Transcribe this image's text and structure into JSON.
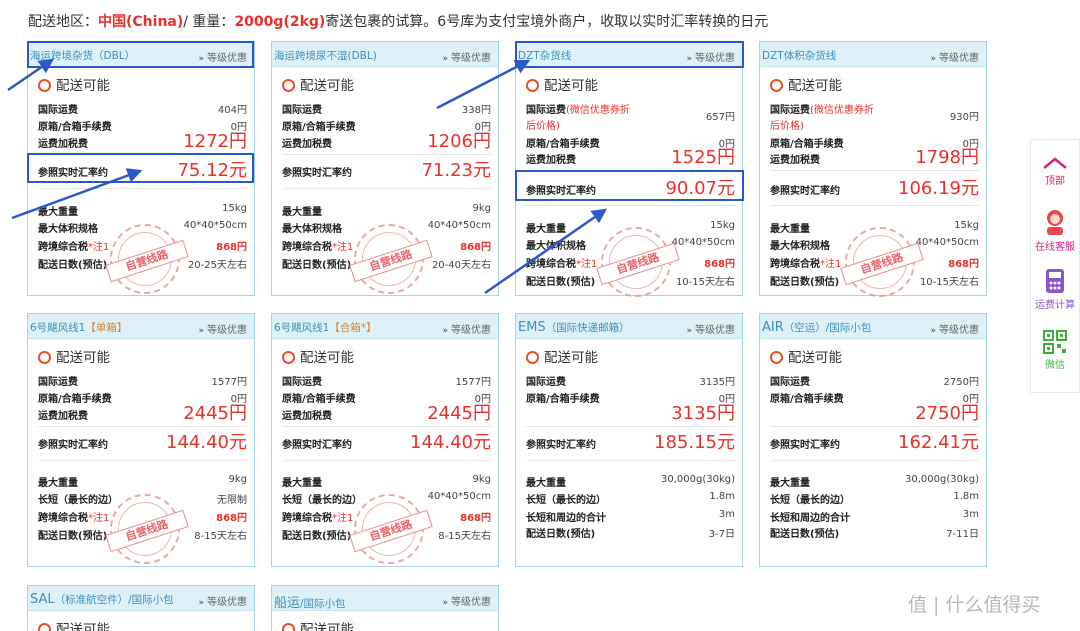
{
  "header": {
    "prefix": "配送地区：",
    "region": "中国(China)",
    "sep": "/ 重量：",
    "weight": "2000g(2kg)",
    "suffix": "寄送包裹的试算。6号库为支付宝境外商户，收取以实时汇率转换的日元"
  },
  "common": {
    "tier": "等级优惠",
    "available": "配送可能",
    "intl_fee": "国际运费",
    "box_fee": "原箱/合箱手续费",
    "tax": "运费加税费",
    "rate": "参照实时汇率约",
    "max_weight": "最大重量",
    "max_size": "最大体积规格",
    "cross_tax": "跨境综合税",
    "note1": "*注1",
    "days": "配送日数(预估)",
    "long_side": "长短（最长的边）",
    "long_sum": "长短和周边的合计",
    "stamp": "自营线路",
    "coupon_note_a": "(微信优惠券折",
    "coupon_note_b": "后价格)",
    "intl_fee_coupon": "国际运费"
  },
  "cards": {
    "c1": {
      "title": "海运跨境杂货（DBL）",
      "intl": "404円",
      "box": "0円",
      "total": "1272円",
      "rate": "75.12元",
      "weight": "15kg",
      "size": "40*40*50cm",
      "cross": "868円",
      "days": "20-25天左右"
    },
    "c2": {
      "title": "海运跨境尿不湿(DBL)",
      "intl": "338円",
      "box": "0円",
      "total": "1206円",
      "rate": "71.23元",
      "weight": "9kg",
      "size": "40*40*50cm",
      "cross": "868円",
      "days": "20-40天左右"
    },
    "c3": {
      "title": "DZT杂货线",
      "intl": "657円",
      "box": "0円",
      "total": "1525円",
      "rate": "90.07元",
      "weight": "15kg",
      "size": "40*40*50cm",
      "cross": "868円",
      "days": "10-15天左右"
    },
    "c4": {
      "title": "DZT体积杂货线",
      "intl": "930円",
      "box": "0円",
      "total": "1798円",
      "rate": "106.19元",
      "weight": "15kg",
      "size": "40*40*50cm",
      "cross": "868円",
      "days": "10-15天左右"
    },
    "c5": {
      "title": "6号飓风线1",
      "title_tag": "【单箱】",
      "intl": "1577円",
      "box": "0円",
      "total": "2445円",
      "rate": "144.40元",
      "weight": "9kg",
      "size": "无限制",
      "cross": "868円",
      "days": "8-15天左右"
    },
    "c6": {
      "title": "6号飓风线1",
      "title_tag": "【合箱*】",
      "intl": "1577円",
      "box": "0円",
      "total": "2445円",
      "rate": "144.40元",
      "weight": "9kg",
      "size": "40*40*50cm",
      "cross": "868円",
      "days": "8-15天左右"
    },
    "c7": {
      "title": "EMS",
      "title_sub": "（国际快递邮箱）",
      "intl": "3135円",
      "box": "0円",
      "total": "3135円",
      "rate": "185.15元",
      "weight": "30,000g(30kg)",
      "side": "1.8m",
      "sum": "3m",
      "days": "3-7日"
    },
    "c8": {
      "title": "AIR",
      "title_sub": "（空运）/国际小包",
      "intl": "2750円",
      "box": "0円",
      "total": "2750円",
      "rate": "162.41元",
      "weight": "30,000g(30kg)",
      "side": "1.8m",
      "sum": "3m",
      "days": "7-11日"
    },
    "c9": {
      "title": "SAL",
      "title_sub": "（标准航空件）/国际小包"
    },
    "c10": {
      "title": "船运",
      "title_sub": "/国际小包"
    }
  },
  "sidebar": {
    "top": "顶部",
    "service": "在线客服",
    "calc": "运费计算",
    "wechat": "微信"
  },
  "watermark": "值 | 什么值得买",
  "colors": {
    "accent_red": "#e8312c",
    "header_blue": "#dff1f8",
    "highlight": "#2c59c8"
  }
}
